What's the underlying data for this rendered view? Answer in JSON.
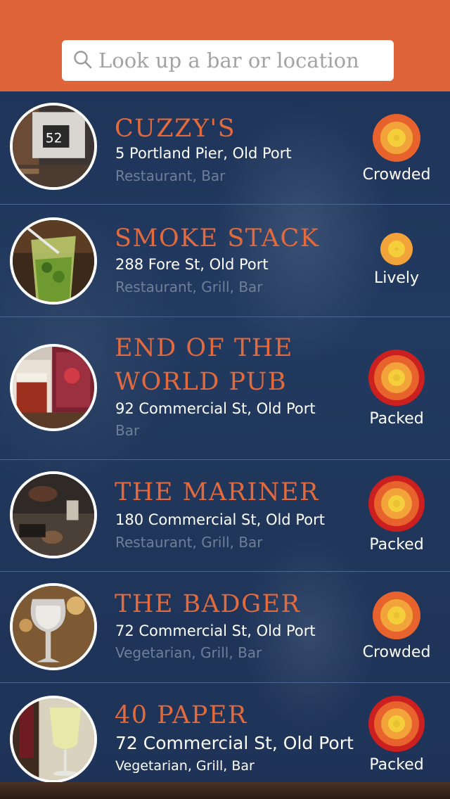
{
  "search": {
    "placeholder": "Look up a bar or location",
    "icon": "search-icon"
  },
  "colors": {
    "header": "#e0643a",
    "accent": "#e36a3c",
    "background": "#1e3357",
    "meter_outer_packed": "#cc1f1f",
    "meter_orange": "#e8622e",
    "meter_light": "#f2a33a",
    "meter_core": "#f5cf3b"
  },
  "venues": [
    {
      "name": "CUZZY'S",
      "address": "5 Portland Pier, Old Port",
      "category": "Restaurant, Bar",
      "status": "Crowded",
      "level": 3
    },
    {
      "name": "SMOKE STACK",
      "address": "288 Fore St, Old Port",
      "category": "Restaurant, Grill, Bar",
      "status": "Lively",
      "level": 2
    },
    {
      "name": "END OF THE\nWORLD PUB",
      "address": "92 Commercial St, Old Port",
      "category": "Bar",
      "status": "Packed",
      "level": 4
    },
    {
      "name": "THE MARINER",
      "address": "180 Commercial St, Old Port",
      "category": "Restaurant, Grill, Bar",
      "status": "Packed",
      "level": 4
    },
    {
      "name": "THE BADGER",
      "address": "72 Commercial St, Old Port",
      "category": "Vegetarian, Grill, Bar",
      "status": "Crowded",
      "level": 3
    },
    {
      "name": "40 PAPER",
      "address": "72 Commercial St, Old Port",
      "category": "Vegetarian, Grill, Bar",
      "status": "Packed",
      "level": 4
    }
  ]
}
